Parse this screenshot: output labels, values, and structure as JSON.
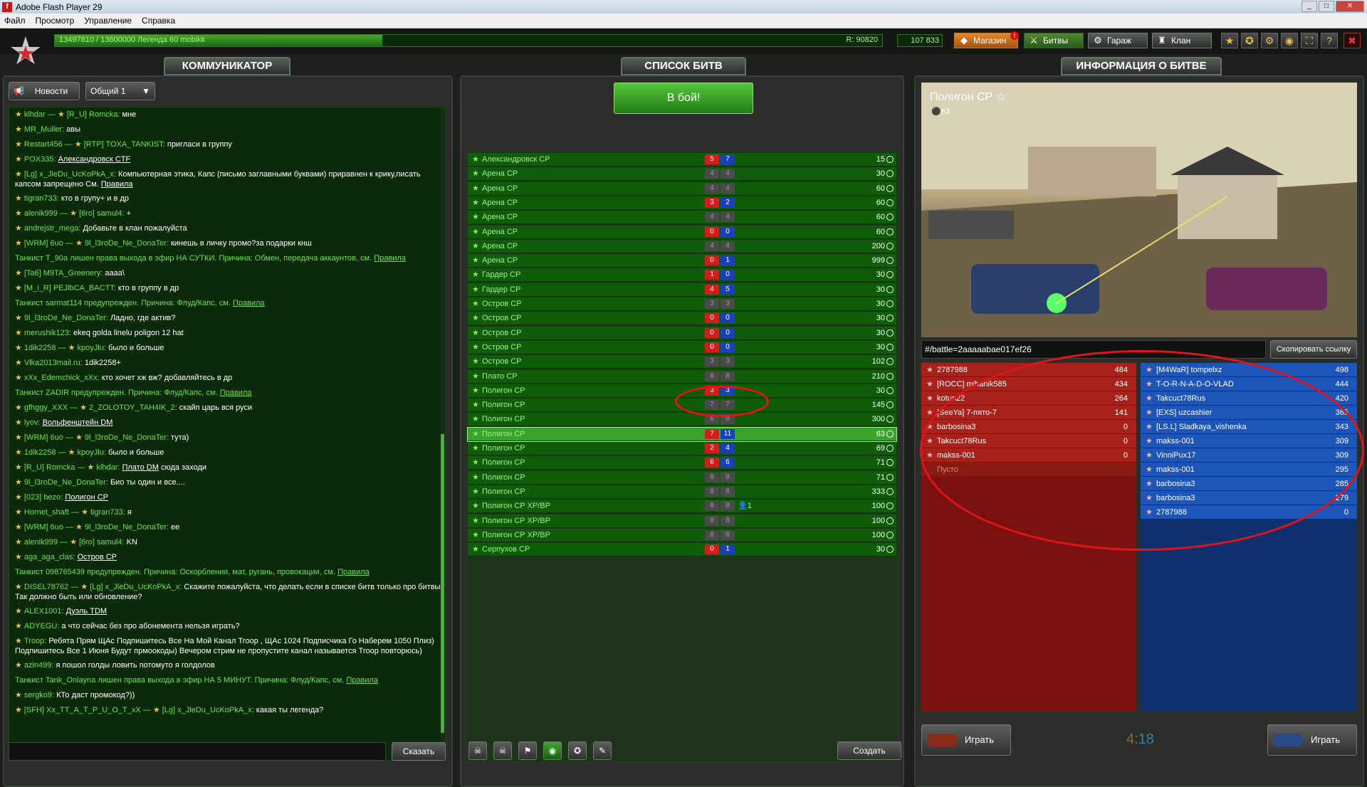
{
  "window": {
    "title": "Adobe Flash Player 29",
    "menu": [
      "Файл",
      "Просмотр",
      "Управление",
      "Справка"
    ]
  },
  "topbar": {
    "xp_text": "13497810 / 13600000 Легенда 60 mobikk",
    "xp_fraction": 0.99,
    "rating": "R: 90820",
    "crystals": "107 833",
    "shop": "Магазин",
    "shop_badge": "!",
    "battles": "Битвы",
    "garage": "Гараж",
    "clan": "Клан",
    "icons": [
      "star-icon",
      "medal-icon",
      "settings-icon",
      "sound-icon",
      "fullscreen-icon",
      "help-icon",
      "close-icon"
    ]
  },
  "communicator": {
    "tab": "КОММУНИКАТОР",
    "news_button": "Новости",
    "channel": "Общий 1",
    "say_button": "Сказать",
    "input_value": "",
    "lines": [
      {
        "u": "klhdar —",
        "u2": "[R_U] Romcka:",
        "t": "мне"
      },
      {
        "u": "MR_Muller:",
        "t": "авы"
      },
      {
        "u": "Restart456 —",
        "u2": "[RTP] TOXA_TANKIST:",
        "t": "пригласи в группу"
      },
      {
        "u": "POX335:",
        "t": "Александровск CTF",
        "link": true
      },
      {
        "u": "[Lg] x_JleDu_UcKoPkA_x:",
        "t": "Компьютерная этика, Капс (письмо заглавными буквами) приравнен к крику,писать капсом запрещено См.",
        "l2": "Правила",
        "two": true
      },
      {
        "u": "tigran733:",
        "t": "кто в групу+ и в др"
      },
      {
        "u": "alenik999 —",
        "u2": "[6ro] samul4:",
        "t": "+"
      },
      {
        "u": "andrejstr_mega:",
        "t": "Добавьте в клан пожалуйста"
      },
      {
        "u": "[WRM] 6uo —",
        "u2": "9l_l3roDe_Ne_DonaTer:",
        "t": "кинешь в личку промо?за подарки кнш"
      },
      {
        "sys": "Танкист T_90a лишен  права выхода в эфир НА СУТКИ. Причина: Обмен, передача аккаунтов, см.",
        "l2": "Правила"
      },
      {
        "u": "[Ta6] M9TA_Greenery:",
        "t": "aaaa\\"
      },
      {
        "u": "[M_i_R] PEJlbCA_BACTT:",
        "t": "кто в группу в др"
      },
      {
        "sys": "Танкист sarmat114 предупрежден. Причина: Флуд/Капс, см.",
        "l2": "Правила"
      },
      {
        "u": "9l_l3roDe_Ne_DonaTer:",
        "t": "Ладно, где актив?"
      },
      {
        "u": "merushik123:",
        "t": "ekeq golda linelu poligon 12 hat"
      },
      {
        "u": "1dik2258 —",
        "u2": "kpoyJlu:",
        "t": "было и больше"
      },
      {
        "u": "Vlka2013mail.ru:",
        "t": "1dik2258+"
      },
      {
        "u": "xXx_Edemchick_xXx:",
        "t": "кто хочет хж вж? добавляйтесь в др"
      },
      {
        "sys": "Танкист ZADIR предупрежден. Причина: Флуд/Капс, см.",
        "l2": "Правила"
      },
      {
        "u": "gfhggy_XXX —",
        "u2": "2_ZOLOTOY_TAH4IK_2:",
        "t": "скайп царь вся руси"
      },
      {
        "u": "lyov:",
        "t": "Вольфенштейн DM",
        "link": true
      },
      {
        "u": "[WRM] 6uo —",
        "u2": "9l_l3roDe_Ne_DonaTer:",
        "t": "тута)"
      },
      {
        "u": "1dik2258 —",
        "u2": "kpoyJlu:",
        "t": "было и больше"
      },
      {
        "u": "[R_U] Romcka —",
        "u2": "klhdar:",
        "t": "Плато DM",
        "t2": " сюда заходи",
        "link": true
      },
      {
        "u": "9l_l3roDe_Ne_DonaTer:",
        "t": "Био ты один и все...."
      },
      {
        "u": "[023] bezo:",
        "t": "Полигон CP",
        "link": true
      },
      {
        "u": "Hornet_shaft —",
        "u2": "tigran733:",
        "t": "я"
      },
      {
        "u": "[WRM] 6uo —",
        "u2": "9l_l3roDe_Ne_DonaTer:",
        "t": "ee"
      },
      {
        "u": "alenik999 —",
        "u2": "[6ro] samul4:",
        "t": "KN"
      },
      {
        "u": "aga_aga_clas:",
        "t": "Остров CP",
        "link": true
      },
      {
        "sys": "Танкист 098765439 предупрежден. Причина: Оскорбления, мат, ругань, провокации, см.",
        "l2": "Правила"
      },
      {
        "u": "DISEL78762 —",
        "u2": "[Lg] x_JleDu_UcKoPkA_x:",
        "t": "Скажите пожалуйста, что делать если в списке битв только про битвы? Так должно быть или обновление?",
        "two": true
      },
      {
        "u": "ALEX1001:",
        "t": "Дуэль TDM",
        "link": true
      },
      {
        "u": "ADYEGU:",
        "t": "а что сейчас без про абонемента нельзя играть?"
      },
      {
        "u": "Troop:",
        "t": "Ребята Прям ЩАс Подпишитесь Все На Мой Канал Troop , ЩАс 1024 Подписчика Го Наберем 1050 Плиз) Подпишитесь Все 1 Июня Будут прмоокоды) Вечером стрим не пропустите канал называется Troop повторюсь)",
        "three": true
      },
      {
        "u": "azin499:",
        "t": "я пошол голды ловить потомуто я голдолов"
      },
      {
        "sys": "Танкист Tank_Onlayna лишен  права выхода в эфир НА 5 МИНУТ. Причина: Флуд/Капс, см.",
        "l2": "Правила"
      },
      {
        "u": "sergko9:",
        "t": "КТо даст промокод?))"
      },
      {
        "u": "[SFH] Xx_TT_A_T_P_U_O_T_xX —",
        "u2": "[Lg] x_JleDu_UcKoPkA_x:",
        "t": "какая ты легенда?"
      }
    ]
  },
  "battles": {
    "tab": "СПИСОК БИТВ",
    "fight_button": "В бой!",
    "create_button": "Создать",
    "rows": [
      {
        "n": "Александровск CP",
        "a": "5",
        "b": "7",
        "c": "15",
        "g": false
      },
      {
        "n": "Арена CP",
        "a": "4",
        "b": "4",
        "c": "30",
        "g": true
      },
      {
        "n": "Арена CP",
        "a": "4",
        "b": "4",
        "c": "60",
        "g": true
      },
      {
        "n": "Арена CP",
        "a": "3",
        "b": "2",
        "c": "60",
        "g": false
      },
      {
        "n": "Арена CP",
        "a": "4",
        "b": "4",
        "c": "60",
        "g": true
      },
      {
        "n": "Арена CP",
        "a": "0",
        "b": "0",
        "c": "60",
        "g": false
      },
      {
        "n": "Арена CP",
        "a": "4",
        "b": "4",
        "c": "200",
        "g": true
      },
      {
        "n": "Арена CP",
        "a": "0",
        "b": "1",
        "c": "999",
        "g": false
      },
      {
        "n": "Гардер CP",
        "a": "1",
        "b": "0",
        "c": "30",
        "g": false
      },
      {
        "n": "Гардер CP",
        "a": "4",
        "b": "5",
        "c": "30",
        "g": false
      },
      {
        "n": "Остров CP",
        "a": "3",
        "b": "3",
        "c": "30",
        "g": true
      },
      {
        "n": "Остров CP",
        "a": "0",
        "b": "0",
        "c": "30",
        "g": false
      },
      {
        "n": "Остров CP",
        "a": "0",
        "b": "0",
        "c": "30",
        "g": false
      },
      {
        "n": "Остров CP",
        "a": "0",
        "b": "0",
        "c": "30",
        "g": false
      },
      {
        "n": "Остров CP",
        "a": "3",
        "b": "3",
        "c": "102",
        "g": true
      },
      {
        "n": "Плато CP",
        "a": "8",
        "b": "8",
        "c": "210",
        "g": true
      },
      {
        "n": "Полигон CP",
        "a": "3",
        "b": "3",
        "c": "30",
        "g": false
      },
      {
        "n": "Полигон CP",
        "a": "7",
        "b": "7",
        "c": "145",
        "g": true
      },
      {
        "n": "Полигон CP",
        "a": "8",
        "b": "8",
        "c": "300",
        "g": true
      },
      {
        "n": "Полигон CP",
        "a": "7",
        "b": "11",
        "c": "63",
        "g": false,
        "sel": true
      },
      {
        "n": "Полигон CP",
        "a": "2",
        "b": "4",
        "c": "69",
        "g": false
      },
      {
        "n": "Полигон CP",
        "a": "6",
        "b": "6",
        "c": "71",
        "g": false
      },
      {
        "n": "Полигон CP",
        "a": "8",
        "b": "8",
        "c": "71",
        "g": true
      },
      {
        "n": "Полигон CP",
        "a": "8",
        "b": "8",
        "c": "333",
        "g": true
      },
      {
        "n": "Полигон CP XP/BP",
        "a": "8",
        "b": "8",
        "c": "100",
        "g": true,
        "extra": "1"
      },
      {
        "n": "Полигон CP XP/BP",
        "a": "8",
        "b": "8",
        "c": "100",
        "g": true
      },
      {
        "n": "Полигон CP XP/BP",
        "a": "8",
        "b": "8",
        "c": "100",
        "g": true
      },
      {
        "n": "Серпухов CP",
        "a": "0",
        "b": "1",
        "c": "30",
        "g": false
      }
    ]
  },
  "info": {
    "tab": "ИНФОРМАЦИЯ О БИТВЕ",
    "map": "Полигон CP",
    "players": "63",
    "link": "#/battle=2aaaaabae017ef26",
    "copy_button": "Скопировать ссылку",
    "red": [
      {
        "n": "2787988",
        "s": "484"
      },
      {
        "n": "[ROCC] mihanik585",
        "s": "434"
      },
      {
        "n": "kotun22",
        "s": "264"
      },
      {
        "n": "[SeeYa] 7-пято-7",
        "s": "141"
      },
      {
        "n": "barbosina3",
        "s": "0"
      },
      {
        "n": "Takcuct78Rus",
        "s": "0"
      },
      {
        "n": "makss-001",
        "s": "0"
      }
    ],
    "red_empty": "Пусто",
    "blue": [
      {
        "n": "[M4WaR] tompelxz",
        "s": "498"
      },
      {
        "n": "T-O-R-N-A-D-O-VLAD",
        "s": "444"
      },
      {
        "n": "Takcuct78Rus",
        "s": "420"
      },
      {
        "n": "[EXS] uzcashier",
        "s": "365"
      },
      {
        "n": "[LS.L] Sladkaya_vishenka",
        "s": "343"
      },
      {
        "n": "makss-001",
        "s": "309"
      },
      {
        "n": "VinniPux17",
        "s": "309"
      },
      {
        "n": "makss-001",
        "s": "295"
      },
      {
        "n": "barbosina3",
        "s": "285"
      },
      {
        "n": "barbosina3",
        "s": "279"
      },
      {
        "n": "2787988",
        "s": "0"
      }
    ],
    "play_red": "Играть",
    "play_blue": "Играть",
    "score_red": "4",
    "score_sep": ":",
    "score_blue": "18"
  }
}
